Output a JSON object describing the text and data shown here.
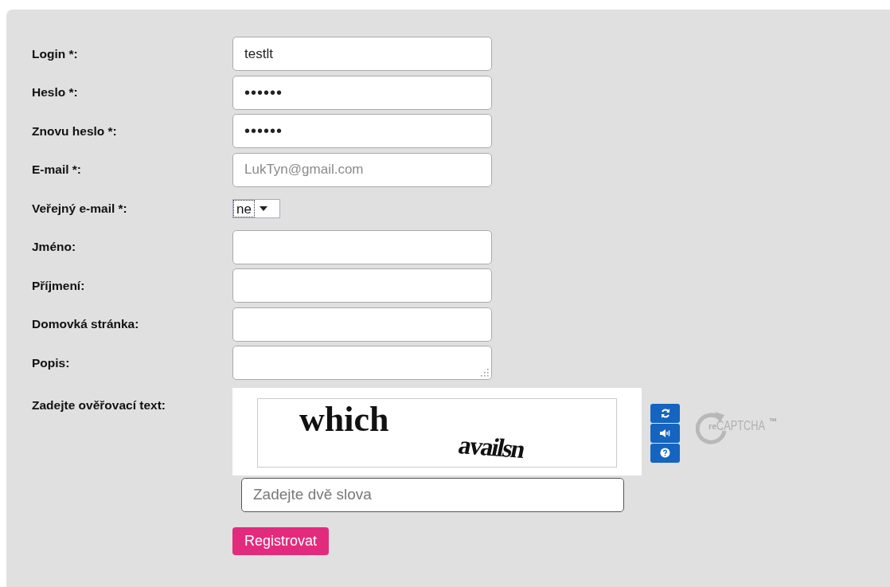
{
  "form": {
    "fields": [
      {
        "label": "Login *:",
        "kind": "text",
        "value": "testlt"
      },
      {
        "label": "Heslo *:",
        "kind": "password",
        "value": "••••••"
      },
      {
        "label": "Znovu heslo *:",
        "kind": "password",
        "value": "••••••"
      },
      {
        "label": "E-mail *:",
        "kind": "email",
        "value": "LukTyn@gmail.com"
      },
      {
        "label": "Veřejný e-mail *:",
        "kind": "select",
        "value": "ne"
      },
      {
        "label": "Jméno:",
        "kind": "text"
      },
      {
        "label": "Příjmení:",
        "kind": "text"
      },
      {
        "label": "Domovká stránka:",
        "kind": "text"
      },
      {
        "label": "Popis:",
        "kind": "textarea"
      }
    ],
    "captcha": {
      "label": "Zadejte ověřovací text:",
      "words": [
        "which",
        "availsn"
      ],
      "logo": {
        "prefix": "re",
        "name": "CAPTCHA",
        "mark": "™"
      },
      "input": {
        "placeholder": "Zadejte dvě slova"
      }
    },
    "submit": "Registrovat"
  }
}
